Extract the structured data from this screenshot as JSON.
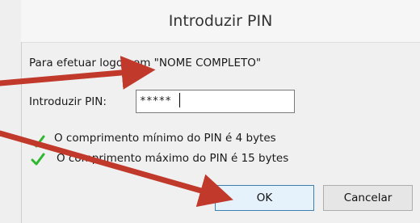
{
  "dialog": {
    "title": "Introduzir PIN",
    "logon_text": "Para efetuar logon em \"NOME COMPLETO\"",
    "pin_label": "Introduzir PIN:",
    "pin_value": "*****",
    "requirements": [
      "O comprimento mínimo do PIN é 4 bytes",
      "O comprimento máximo do PIN é 15 bytes"
    ],
    "buttons": {
      "ok": "OK",
      "cancel": "Cancelar"
    }
  },
  "colors": {
    "arrow": "#c0392b",
    "check": "#2db82d",
    "ok_border": "#3c7fb1"
  },
  "icons": [
    "check-icon",
    "arrow-annotation"
  ]
}
